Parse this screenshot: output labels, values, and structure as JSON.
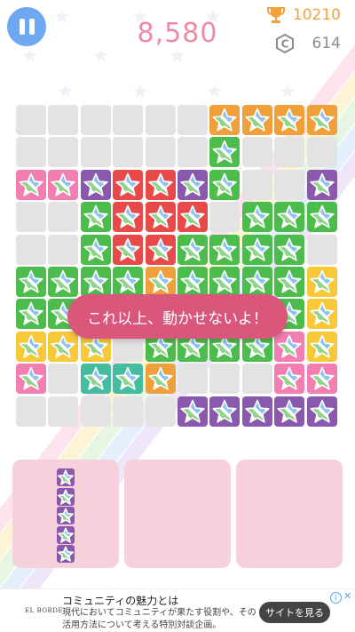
{
  "colors": {
    "orange": "#f0a03a",
    "green": "#4cbc4c",
    "red": "#e84a4a",
    "purple": "#8a58ad",
    "pink": "#f27eb2",
    "yellow": "#f6c83a",
    "teal": "#44bca0",
    "empty": "#e3e3e3",
    "score": "#ef8aa6",
    "toast": "#d9577a",
    "tray": "#f6d1dc",
    "pause": "#6ea8f0"
  },
  "header": {
    "pause_icon": "pause-icon",
    "score": "8,580",
    "hiscore_icon": "trophy-icon",
    "hiscore": "10210",
    "coin_icon": "coin-c-icon",
    "coins": "614"
  },
  "board": {
    "size": 10,
    "rows": [
      "......OOOO",
      "......G...",
      "PPURRUG..U",
      "..GRRR.GGG",
      "..GRRGGGG.",
      "GGGWOGGGGY",
      "GWG.OGGGGY",
      "YYY.GGGGPY",
      "P.TTO...PP",
      ".....UUUUU"
    ],
    "legend": {
      "O": "orange",
      "G": "green",
      "R": "red",
      "U": "purple",
      "P": "pink",
      "Y": "yellow",
      "T": "teal",
      "W": "green",
      ".": "empty"
    }
  },
  "toast": {
    "message": "これ以上、動かせないよ！"
  },
  "trays": [
    {
      "name": "tray-1",
      "piece_color": "purple",
      "piece_cells": 5,
      "piece_shape": "vertical-I5"
    },
    {
      "name": "tray-2",
      "piece_color": null,
      "piece_cells": 0
    },
    {
      "name": "tray-3",
      "piece_color": null,
      "piece_cells": 0
    }
  ],
  "ad": {
    "brand": "EL BORDE",
    "title": "コミュニティの魅力とは",
    "description": "現代においてコミュニティが果たす役割や、その活用方法について考える特別対談企画。",
    "cta": "サイトを見る",
    "info_icon": "info-icon",
    "close_icon": "close-icon"
  }
}
